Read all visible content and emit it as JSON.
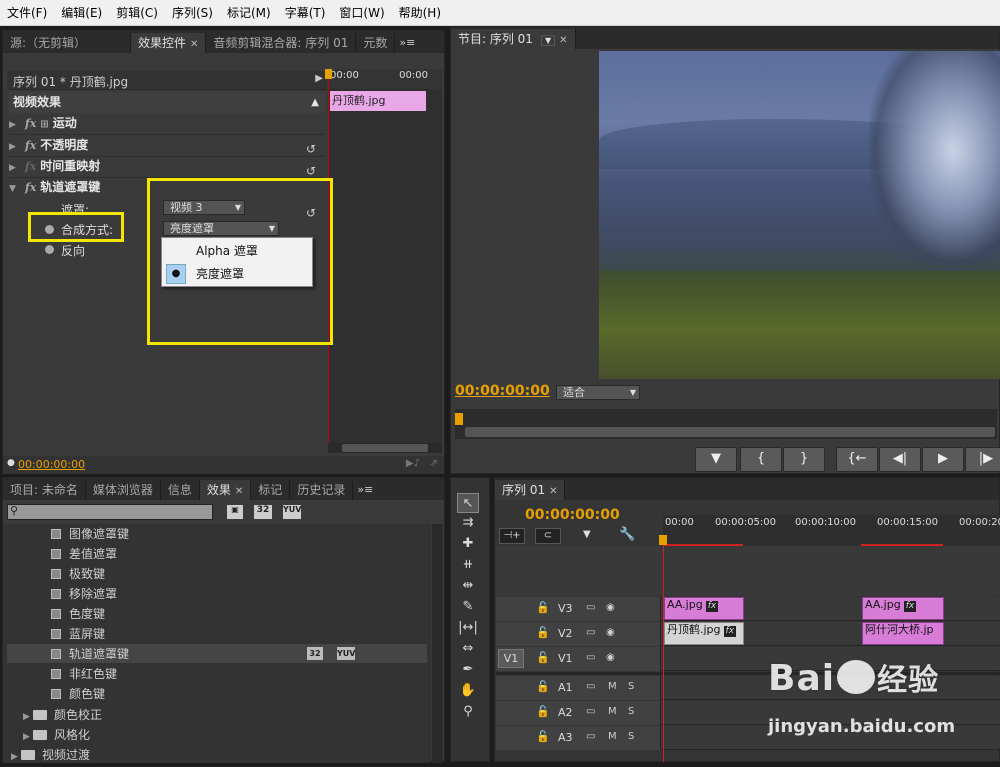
{
  "menu": [
    "文件(F)",
    "编辑(E)",
    "剪辑(C)",
    "序列(S)",
    "标记(M)",
    "字幕(T)",
    "窗口(W)",
    "帮助(H)"
  ],
  "effect_controls": {
    "tabs": [
      "源:（无剪辑）",
      "效果控件",
      "音频剪辑混合器: 序列 01",
      "元数"
    ],
    "sequence": "序列 01 * 丹顶鹤.jpg",
    "ruler_left": "00:00",
    "ruler_right": "00:00",
    "clip_label": "丹顶鹤.jpg",
    "section": "视频效果",
    "effects": [
      "运动",
      "不透明度",
      "时间重映射",
      "轨道遮罩键"
    ],
    "mask_label": "遮罩:",
    "mask_value": "视频 3",
    "composite_label": "合成方式:",
    "composite_value": "亮度遮罩",
    "reverse_label": "反向",
    "dropdown_options": [
      "Alpha 遮罩",
      "亮度遮罩"
    ],
    "dropdown_selected": 1,
    "timecode": "00:00:00:00"
  },
  "program": {
    "tab": "节目: 序列 01",
    "timecode": "00:00:00:00",
    "fit": "适合",
    "transport": [
      "▼",
      "{",
      "}",
      "{←",
      "◀|",
      "▶",
      "|▶"
    ]
  },
  "project": {
    "tabs": [
      "项目: 未命名",
      "媒体浏览器",
      "信息",
      "效果",
      "标记",
      "历史记录"
    ],
    "badges": [
      "32",
      "YUV"
    ],
    "items": [
      "图像遮罩键",
      "差值遮罩",
      "极致键",
      "移除遮罩",
      "色度键",
      "蓝屏键",
      "轨道遮罩键",
      "非红色键",
      "颜色键"
    ],
    "selected_item": "轨道遮罩键",
    "folders": [
      "颜色校正",
      "风格化",
      "视频过渡"
    ]
  },
  "timeline": {
    "tab": "序列 01",
    "timecode": "00:00:00:00",
    "ruler": [
      "00:00",
      "00:00:05:00",
      "00:00:10:00",
      "00:00:15:00",
      "00:00:20"
    ],
    "video_tracks": [
      "V3",
      "V2",
      "V1"
    ],
    "audio_tracks": [
      "A1",
      "A2",
      "A3"
    ],
    "source_patch": "V1",
    "m": "M",
    "s": "S",
    "clips": {
      "v3_a": "AA.jpg",
      "v3_b": "AA.jpg",
      "v2_a": "丹顶鹤.jpg",
      "v2_b": "阿什河大桥.jp"
    },
    "fx": "fx"
  },
  "watermark": {
    "brand": "Bai",
    "brand2": "经验",
    "url": "jingyan.baidu.com"
  },
  "colors": {
    "accent": "#e8a000",
    "highlight": "#f5e600",
    "clip_pink": "#d77cd7",
    "clip_green": "#d4d4d4"
  }
}
